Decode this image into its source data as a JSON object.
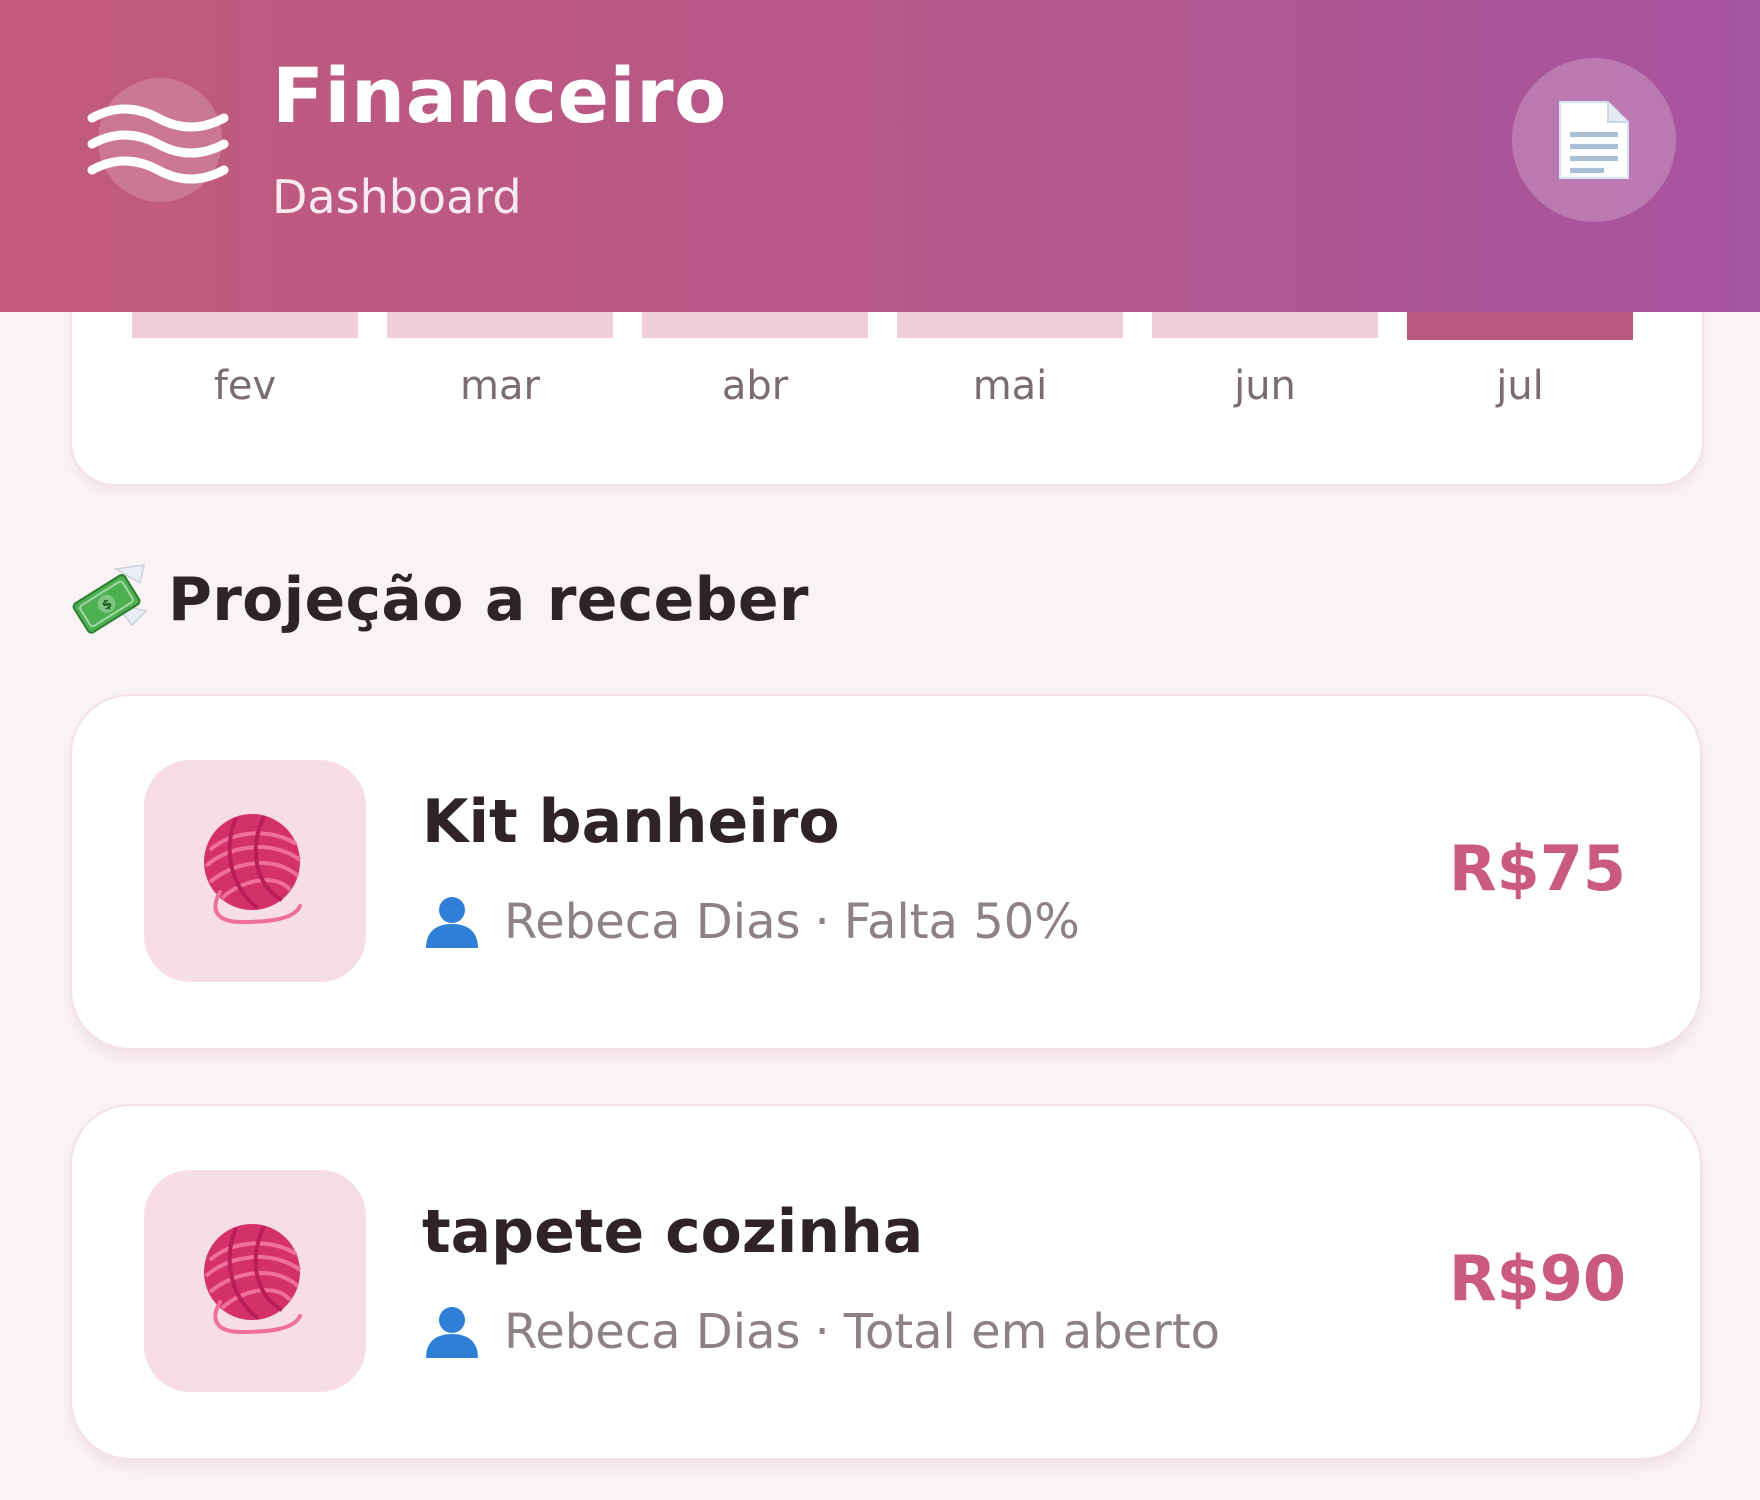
{
  "header": {
    "title": "Financeiro",
    "subtitle": "Dashboard",
    "logo_icon": "waves-icon",
    "report_icon": "document-icon"
  },
  "chart": {
    "months": [
      "fev",
      "mar",
      "abr",
      "mai",
      "jun",
      "jul"
    ],
    "active_month": "jul",
    "bar_color": "#f0cfdb",
    "active_bar_color": "#b95a80"
  },
  "section": {
    "icon": "money-with-wings-icon",
    "title": "Projeção a receber"
  },
  "receivables": [
    {
      "name": "Kit banheiro",
      "client": "Rebeca Dias",
      "status": "Falta 50%",
      "amount": "R$75",
      "icon": "yarn-ball-icon"
    },
    {
      "name": "tapete cozinha",
      "client": "Rebeca Dias",
      "status": "Total em aberto",
      "amount": "R$90",
      "icon": "yarn-ball-icon"
    }
  ],
  "colors": {
    "header_start": "#c25a7c",
    "header_end": "#a653a0",
    "amount": "#cb5a7f",
    "thumb_bg": "#f7dde8",
    "page_bg": "#faf3f5"
  }
}
